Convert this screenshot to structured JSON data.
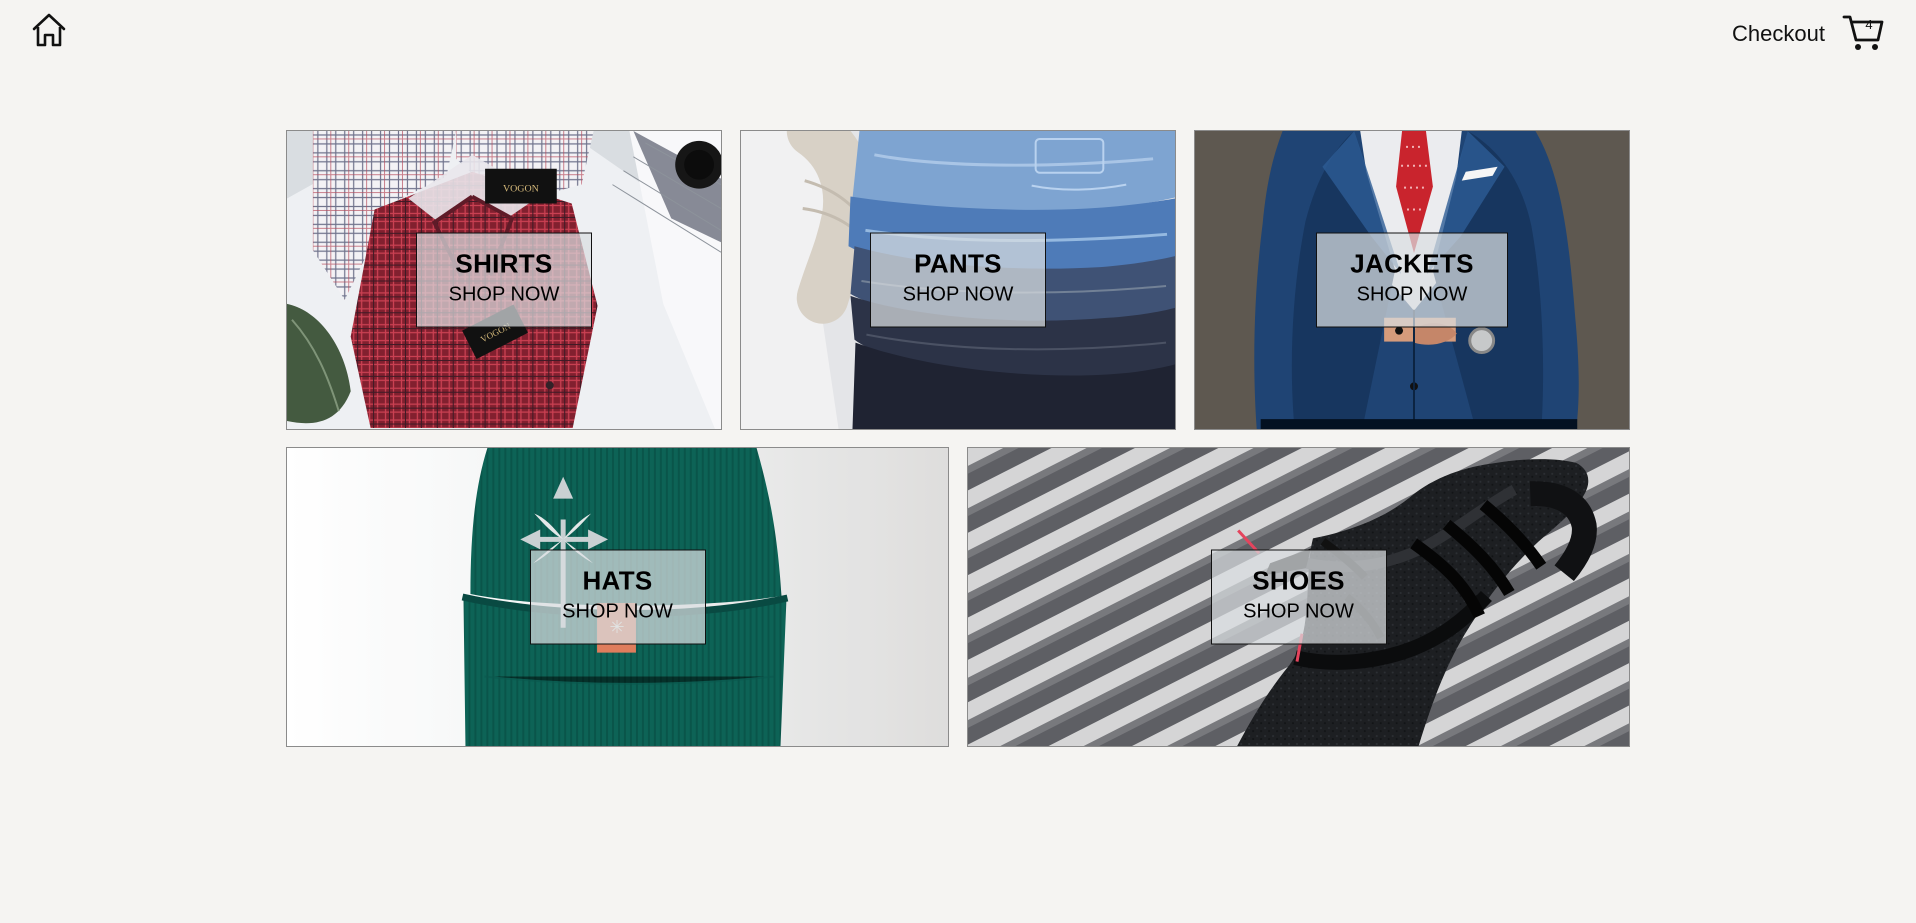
{
  "header": {
    "home_icon": "home-icon",
    "checkout_label": "Checkout",
    "cart_icon": "shopping-cart-icon",
    "cart_count": "4"
  },
  "categories": [
    {
      "title": "SHIRTS",
      "cta": "SHOP NOW",
      "image_label": "VOGON",
      "image_label_second": "VOGON",
      "colors": {
        "base": "#d9dde1",
        "accent": "#8f2837",
        "check": "#be3448"
      }
    },
    {
      "title": "PANTS",
      "cta": "SHOP NOW",
      "colors": {
        "base": "#e4e5e8",
        "accent": "#4b79b8",
        "dark": "#2c3347"
      }
    },
    {
      "title": "JACKETS",
      "cta": "SHOP NOW",
      "colors": {
        "base": "#5e5850",
        "accent": "#1f4474",
        "tie": "#c9242d"
      }
    },
    {
      "title": "HATS",
      "cta": "SHOP NOW",
      "colors": {
        "base": "#f0f1f1",
        "accent": "#0d6356",
        "tag": "#df7d5d"
      }
    },
    {
      "title": "SHOES",
      "cta": "SHOP NOW",
      "colors": {
        "base": "#9b9c9f",
        "accent": "#1b1c1e",
        "lace": "#e4445d"
      }
    }
  ]
}
